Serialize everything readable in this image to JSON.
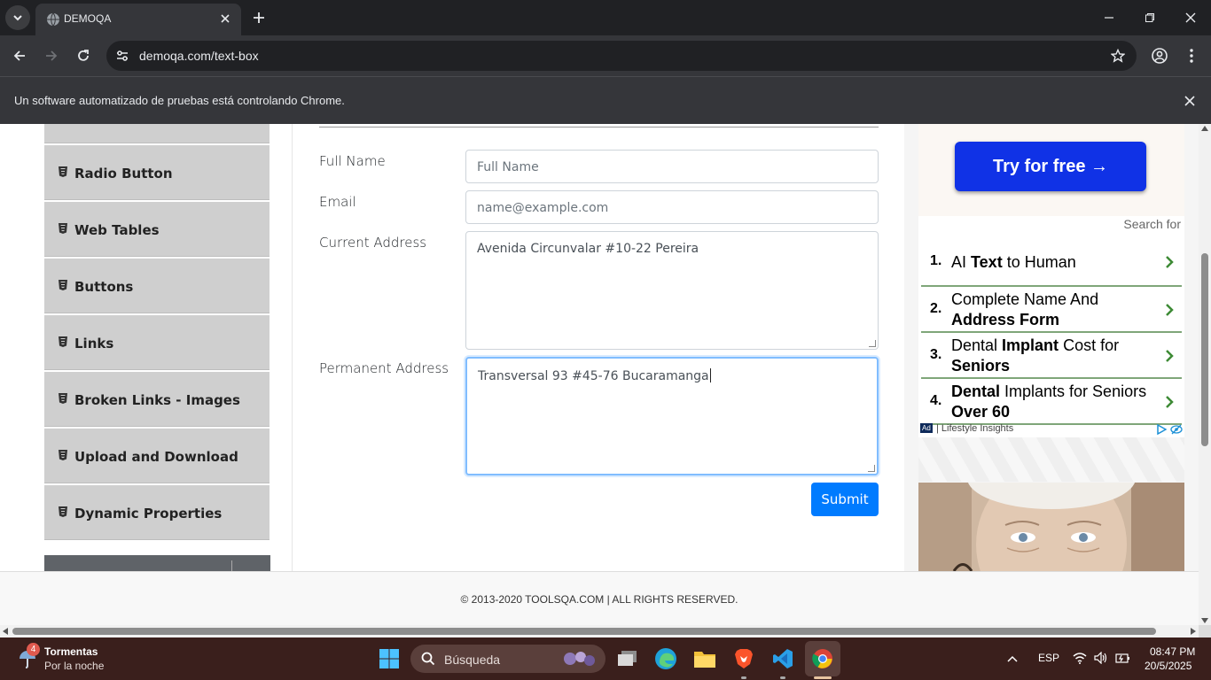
{
  "browser": {
    "tab_title": "DEMOQA",
    "url": "demoqa.com/text-box",
    "automation_notice": "Un software automatizado de pruebas está controlando Chrome."
  },
  "sidebar": {
    "items": [
      {
        "label": "Radio Button"
      },
      {
        "label": "Web Tables"
      },
      {
        "label": "Buttons"
      },
      {
        "label": "Links"
      },
      {
        "label": "Broken Links - Images"
      },
      {
        "label": "Upload and Download"
      },
      {
        "label": "Dynamic Properties"
      }
    ]
  },
  "form": {
    "full_name_label": "Full Name",
    "full_name_placeholder": "Full Name",
    "email_label": "Email",
    "email_placeholder": "name@example.com",
    "current_address_label": "Current Address",
    "current_address_value": "Avenida Circunvalar #10-22 Pereira",
    "permanent_address_label": "Permanent Address",
    "permanent_address_value": "Transversal 93 #45-76 Bucaramanga",
    "submit_label": "Submit"
  },
  "ad": {
    "cta": "Try for free →",
    "search_for": "Search for",
    "items": [
      {
        "num": "1.",
        "pre": "AI ",
        "bold": "Text",
        "post": " to Human",
        "bold2": ""
      },
      {
        "num": "2.",
        "pre": "Complete Name And ",
        "bold": "Address Form",
        "post": "",
        "bold2": ""
      },
      {
        "num": "3.",
        "pre": "Dental ",
        "bold": "Implant",
        "post": " Cost for ",
        "bold2": "Seniors"
      },
      {
        "num": "4.",
        "pre": "",
        "bold": "Dental",
        "post": " Implants for Seniors ",
        "bold2": "Over",
        "tail": " 60"
      }
    ],
    "badge": "Ad",
    "brand": "| Lifestyle Insights"
  },
  "footer": {
    "copyright": "© 2013-2020 TOOLSQA.COM | ALL RIGHTS RESERVED."
  },
  "taskbar": {
    "weather_title": "Tormentas",
    "weather_sub": "Por la noche",
    "weather_badge": "4",
    "search_label": "Búsqueda",
    "lang": "ESP",
    "time": "08:47 PM",
    "date": "20/5/2025"
  },
  "colors": {
    "accent": "#007bff",
    "sidebar_bg": "#cfcfcf",
    "taskbar_bg": "#3a1f1c"
  }
}
